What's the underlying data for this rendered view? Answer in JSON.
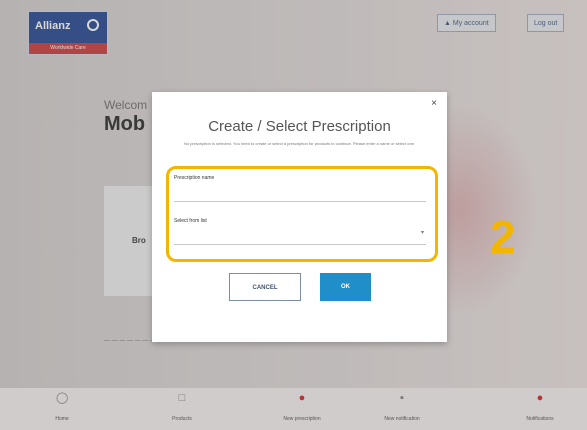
{
  "header": {
    "logo_text": "Allianz",
    "logo_subtext": "Worldwide Care",
    "my_account_label": "▲ My account",
    "logout_label": "Log out"
  },
  "background": {
    "welcome_small": "Welcom",
    "welcome_big": "Mob"
  },
  "modal": {
    "title": "Create / Select Prescription",
    "subtitle": "No prescription is selected. You need to create or select a prescription for products to continue. Please enter a name or select one.",
    "close_label": "×",
    "field_name_label": "Prescription name",
    "field_select_label": "Select from list",
    "cancel_label": "CANCEL",
    "ok_label": "OK"
  },
  "annotation": {
    "step_number": "2",
    "color": "#f2b600"
  },
  "bottom_nav": {
    "items": [
      {
        "label": "Home",
        "icon": "home-icon"
      },
      {
        "label": "Products",
        "icon": "products-icon"
      },
      {
        "label": "New prescription",
        "icon": "prescription-icon"
      },
      {
        "label": "New notification",
        "icon": "notification-icon"
      },
      {
        "label": "Notifications",
        "icon": "bell-icon"
      }
    ]
  },
  "colors": {
    "brand_blue": "#1e3f8c",
    "ok_blue": "#1f8ec9",
    "highlight": "#f2b600"
  }
}
